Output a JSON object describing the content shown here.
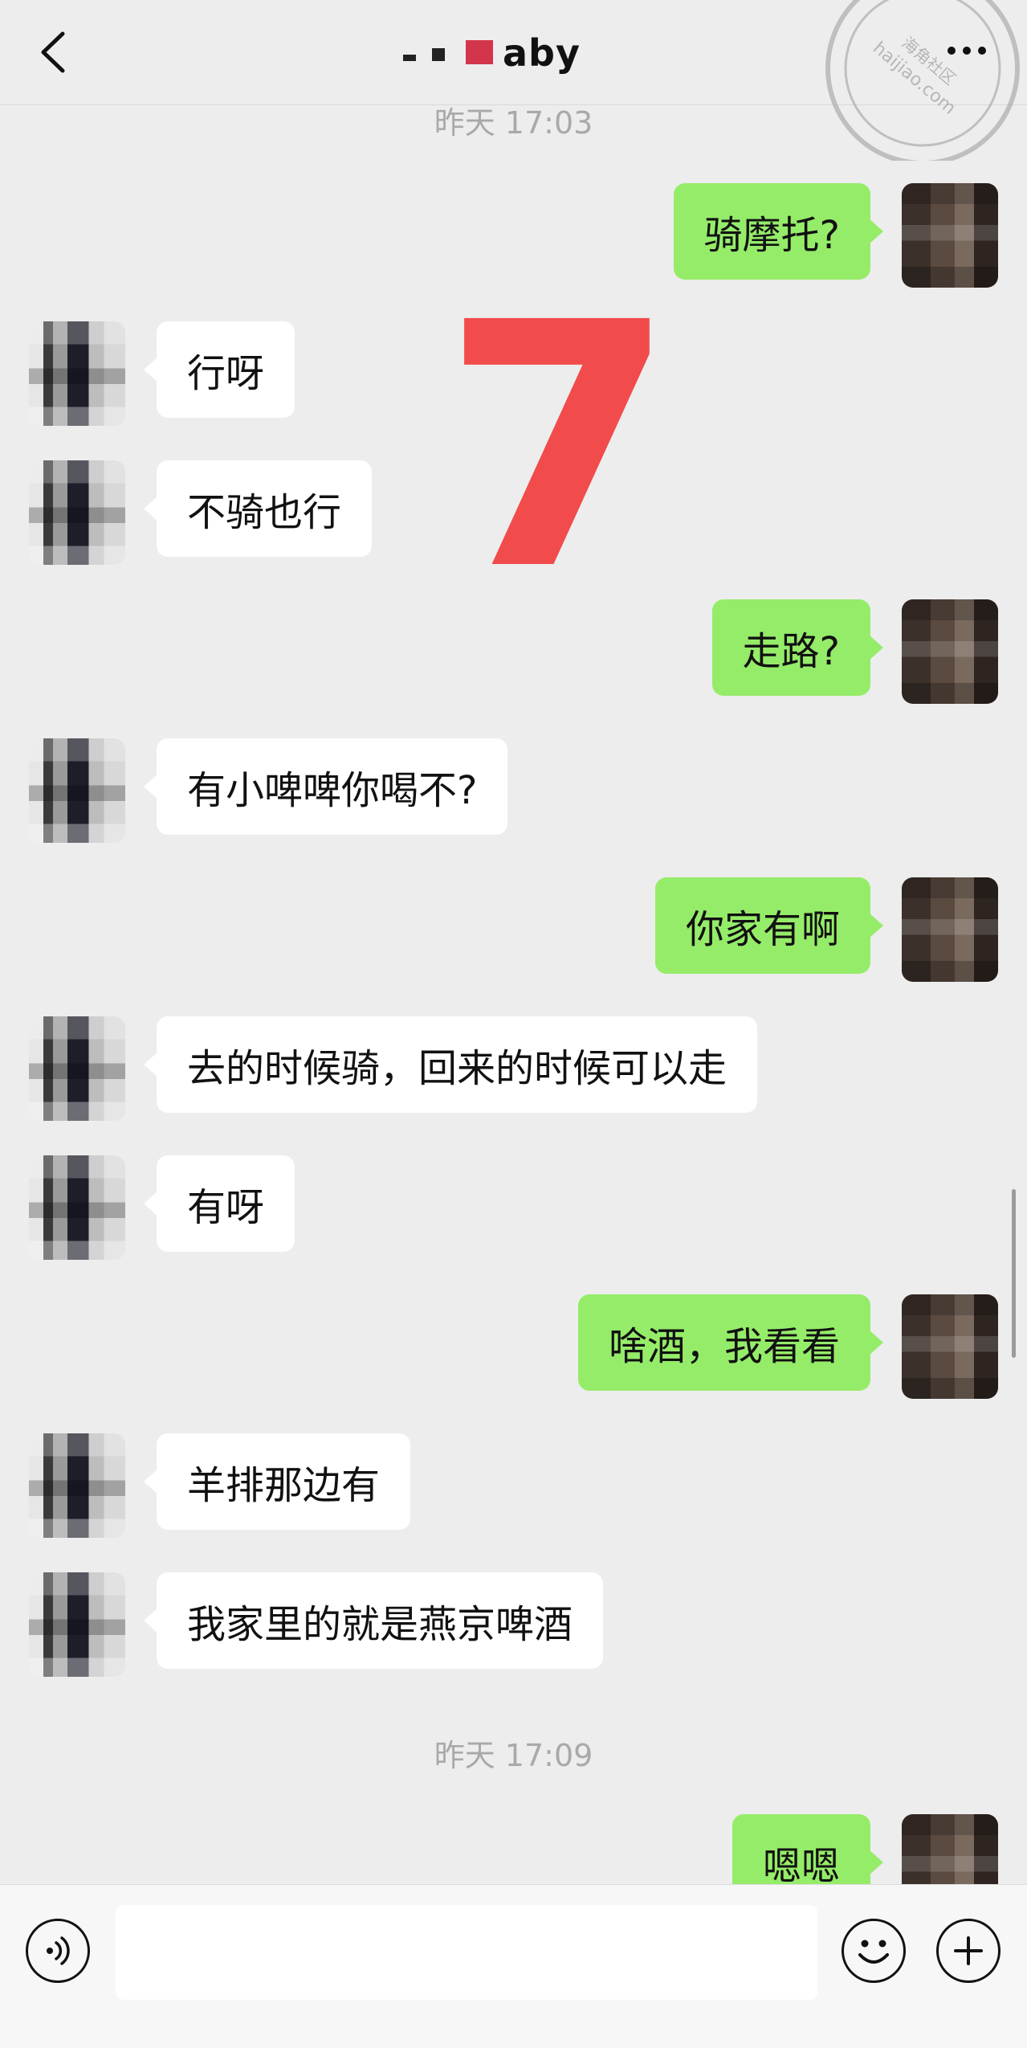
{
  "header": {
    "title": "aby"
  },
  "watermark": {
    "line1": "海角社区",
    "line2": "haijiao.com"
  },
  "big_number": "7",
  "timestamps": [
    "昨天 17:03",
    "昨天 17:09"
  ],
  "messages": [
    {
      "side": "right",
      "text": "骑摩托?"
    },
    {
      "side": "left",
      "text": "行呀"
    },
    {
      "side": "left",
      "text": "不骑也行"
    },
    {
      "side": "right",
      "text": "走路?"
    },
    {
      "side": "left",
      "text": "有小啤啤你喝不?"
    },
    {
      "side": "right",
      "text": "你家有啊"
    },
    {
      "side": "left",
      "text": "去的时候骑，回来的时候可以走"
    },
    {
      "side": "left",
      "text": "有呀"
    },
    {
      "side": "right",
      "text": "啥酒，我看看"
    },
    {
      "side": "left",
      "text": "羊排那边有"
    },
    {
      "side": "left",
      "text": "我家里的就是燕京啤酒"
    },
    {
      "side": "right",
      "text": "嗯嗯"
    }
  ],
  "input": {
    "value": ""
  },
  "icons": [
    "back-arrow-icon",
    "more-dots-icon",
    "voice-icon",
    "emoji-icon",
    "plus-icon"
  ]
}
